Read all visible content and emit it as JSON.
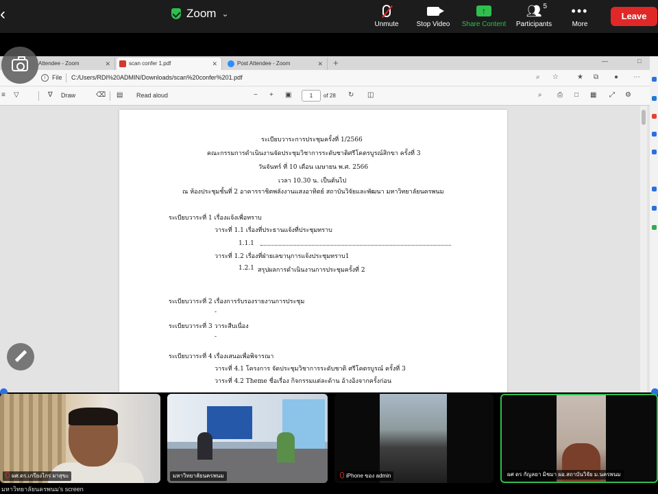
{
  "zoom": {
    "title": "Zoom",
    "controls": {
      "unmute": "Unmute",
      "stop_video": "Stop Video",
      "share_content": "Share Content",
      "participants": "Participants",
      "participant_count": "5",
      "more": "More",
      "leave": "Leave"
    },
    "accent_green": "#2fbf4f",
    "leave_red": "#e02828"
  },
  "browser": {
    "tabs": [
      {
        "label": "Attendee - Zoom"
      },
      {
        "label": "scan confer 1.pdf"
      },
      {
        "label": "Post Attendee - Zoom"
      }
    ],
    "address": {
      "scheme": "File",
      "url": "C:/Users/RDI%20ADMIN/Downloads/scan%20confer%201.pdf"
    },
    "pdf_toolbar": {
      "draw": "Draw",
      "read_aloud": "Read aloud",
      "page_number": "1",
      "page_total": "of 28"
    }
  },
  "document": {
    "lines": [
      "ระเบียบวาระการประชุมครั้งที่ 1/2566",
      "คณะกรรมการดำเนินงานจัดประชุมวิชาการระดับชาติศรีโคตรบูรณ์สิกขา ครั้งที่ 3",
      "วันจันทร์ ที่ 10 เดือน เมษายน พ.ศ. 2566",
      "เวลา 10.30 น. เป็นต้นไป",
      "ณ ห้องประชุมชั้นที่ 2 อาคารราชิตพลังงานแสงอาทิตย์ สถาบันวิจัยและพัฒนา มหาวิทยาลัยนครพนม",
      "ระเบียบวาระที่ 1 เรื่องแจ้งเพื่อทราบ",
      "วาระที่ 1.1 เรื่องที่ประธานแจ้งที่ประชุมทราบ",
      "1.1.1",
      "วาระที่ 1.2 เรื่องที่ฝ่ายเลขานุการแจ้งประชุมทราบ1",
      "1.2.1",
      "สรุปผลการดำเนินงานการประชุมครั้งที่ 2",
      "ระเบียบวาระที่ 2 เรื่องการรับรองรายงานการประชุม",
      "-",
      "ระเบียบวาระที่ 3 วาระสืบเนื่อง",
      "-",
      "ระเบียบวาระที่ 4 เรื่องเสนอเพื่อพิจารณา",
      "วาระที่ 4.1 โครงการ จัดประชุมวิชาการระดับชาติ ศรีโคตรบูรณ์ ครั้งที่ 3",
      "วาระที่ 4.2 Theme ชื่อเรื่อง กิจกรรมแต่ละด้าน อ้างอิงจากครั้งก่อน"
    ]
  },
  "participants": [
    {
      "name": "ผศ.ดร.เกรียงไกร ผาสุขะ",
      "muted": true
    },
    {
      "name": "มหาวิทยาลัยนครพนม",
      "muted": false
    },
    {
      "name": "iPhone ของ admin",
      "muted": true
    },
    {
      "name": "ผศ ดร กัญลยา มิชมา ผอ.สถาบันวิจัย ม.นครพนม",
      "muted": false
    }
  ],
  "screen_label": "มหาวิทยาลัยนครพนม's screen"
}
